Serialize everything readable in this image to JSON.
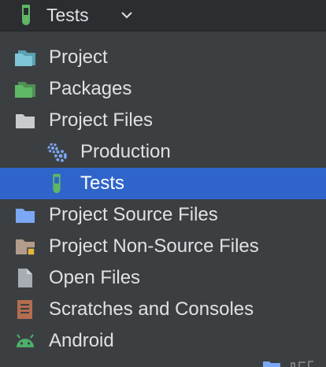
{
  "header": {
    "title": "Tests",
    "icon": "test-flask-icon",
    "dropdown_icon": "chevron-down-icon"
  },
  "tree": [
    {
      "label": "Project",
      "icon": "folder-teal-icon",
      "indent": 0,
      "selected": false
    },
    {
      "label": "Packages",
      "icon": "folder-green-icon",
      "indent": 0,
      "selected": false
    },
    {
      "label": "Project Files",
      "icon": "folder-gray-icon",
      "indent": 0,
      "selected": false
    },
    {
      "label": "Production",
      "icon": "gears-icon",
      "indent": 1,
      "selected": false
    },
    {
      "label": "Tests",
      "icon": "test-flask-icon",
      "indent": 1,
      "selected": true
    },
    {
      "label": "Project Source Files",
      "icon": "folder-blue-icon",
      "indent": 0,
      "selected": false
    },
    {
      "label": "Project Non-Source Files",
      "icon": "folder-brown-icon",
      "indent": 0,
      "selected": false
    },
    {
      "label": "Open Files",
      "icon": "file-icon",
      "indent": 0,
      "selected": false
    },
    {
      "label": "Scratches and Consoles",
      "icon": "scratches-icon",
      "indent": 0,
      "selected": false
    },
    {
      "label": "Android",
      "icon": "android-icon",
      "indent": 0,
      "selected": false
    }
  ],
  "colors": {
    "panel_bg": "#3c3f41",
    "header_bg": "#2b2d30",
    "selection": "#2f65ca",
    "text": "#dfe1e5",
    "accent_green": "#5fb865",
    "folder_blue": "#7ca7f5",
    "folder_teal": "#7fc6d6"
  }
}
